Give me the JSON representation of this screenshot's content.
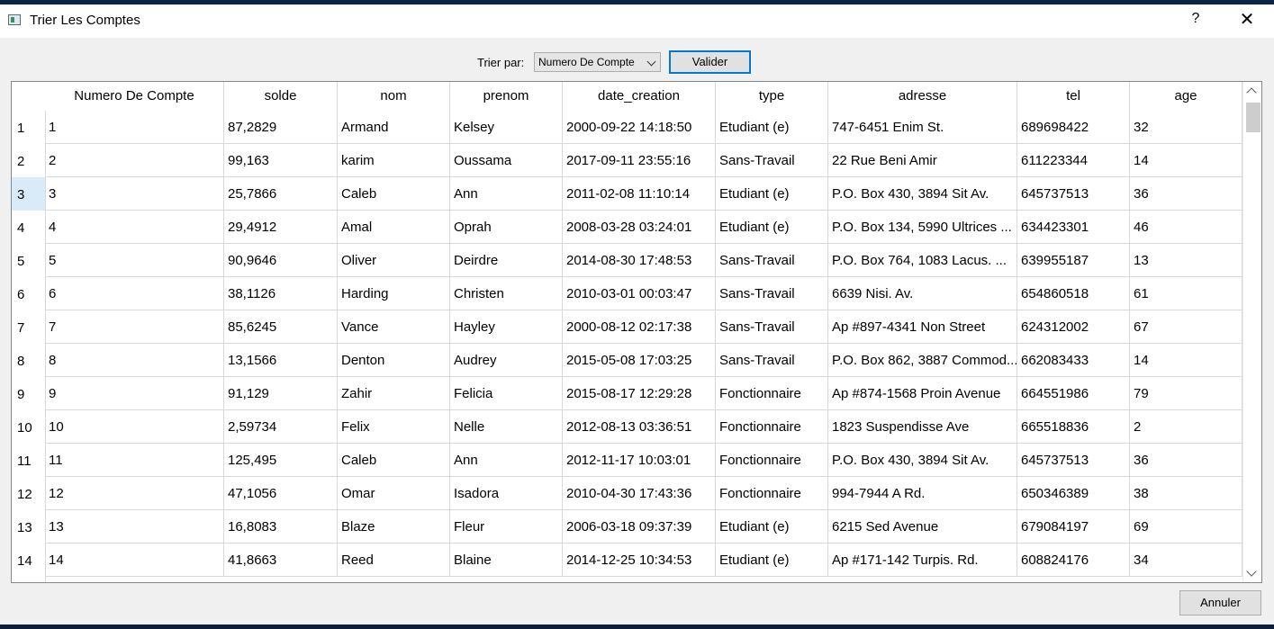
{
  "window": {
    "title": "Trier Les Comptes",
    "help_label": "?",
    "close_label": "✕"
  },
  "sort_bar": {
    "label": "Trier par:",
    "selected": "Numero De Compte",
    "validate_label": "Valider"
  },
  "table": {
    "columns": [
      "Numero De Compte",
      "solde",
      "nom",
      "prenom",
      "date_creation",
      "type",
      "adresse",
      "tel",
      "age"
    ],
    "selected_row_header": 3,
    "rows": [
      [
        "1",
        "1",
        "87,2829",
        "Armand",
        "Kelsey",
        "2000-09-22 14:18:50",
        "Etudiant (e)",
        "747-6451 Enim St.",
        "689698422",
        "32"
      ],
      [
        "2",
        "2",
        "99,163",
        "karim",
        "Oussama",
        "2017-09-11 23:55:16",
        "Sans-Travail",
        "22 Rue Beni Amir",
        "611223344",
        "14"
      ],
      [
        "3",
        "3",
        "25,7866",
        "Caleb",
        "Ann",
        "2011-02-08 11:10:14",
        "Etudiant (e)",
        "P.O. Box 430, 3894 Sit Av.",
        "645737513",
        "36"
      ],
      [
        "4",
        "4",
        "29,4912",
        "Amal",
        "Oprah",
        "2008-03-28 03:24:01",
        "Etudiant (e)",
        "P.O. Box 134, 5990 Ultrices ...",
        "634423301",
        "46"
      ],
      [
        "5",
        "5",
        "90,9646",
        "Oliver",
        "Deirdre",
        "2014-08-30 17:48:53",
        "Sans-Travail",
        "P.O. Box 764, 1083 Lacus. ...",
        "639955187",
        "13"
      ],
      [
        "6",
        "6",
        "38,1126",
        "Harding",
        "Christen",
        "2010-03-01 00:03:47",
        "Sans-Travail",
        "6639 Nisi. Av.",
        "654860518",
        "61"
      ],
      [
        "7",
        "7",
        "85,6245",
        "Vance",
        "Hayley",
        "2000-08-12 02:17:38",
        "Sans-Travail",
        "Ap #897-4341 Non Street",
        "624312002",
        "67"
      ],
      [
        "8",
        "8",
        "13,1566",
        "Denton",
        "Audrey",
        "2015-05-08 17:03:25",
        "Sans-Travail",
        "P.O. Box 862, 3887 Commod...",
        "662083433",
        "14"
      ],
      [
        "9",
        "9",
        "91,129",
        "Zahir",
        "Felicia",
        "2015-08-17 12:29:28",
        "Fonctionnaire",
        "Ap #874-1568 Proin Avenue",
        "664551986",
        "79"
      ],
      [
        "10",
        "10",
        "2,59734",
        "Felix",
        "Nelle",
        "2012-08-13 03:36:51",
        "Fonctionnaire",
        "1823 Suspendisse Ave",
        "665518836",
        "2"
      ],
      [
        "11",
        "11",
        "125,495",
        "Caleb",
        "Ann",
        "2012-11-17 10:03:01",
        "Fonctionnaire",
        "P.O. Box 430, 3894 Sit Av.",
        "645737513",
        "36"
      ],
      [
        "12",
        "12",
        "47,1056",
        "Omar",
        "Isadora",
        "2010-04-30 17:43:36",
        "Fonctionnaire",
        "994-7944 A Rd.",
        "650346389",
        "38"
      ],
      [
        "13",
        "13",
        "16,8083",
        "Blaze",
        "Fleur",
        "2006-03-18 09:37:39",
        "Etudiant (e)",
        "6215 Sed Avenue",
        "679084197",
        "69"
      ],
      [
        "14",
        "14",
        "41,8663",
        "Reed",
        "Blaine",
        "2014-12-25 10:34:53",
        "Etudiant (e)",
        "Ap #171-142 Turpis. Rd.",
        "608824176",
        "34"
      ]
    ]
  },
  "footer": {
    "cancel_label": "Annuler"
  },
  "colors": {
    "accent": "#0078d7",
    "selection": "#d9ebf9",
    "grid": "#d9d9d9"
  }
}
